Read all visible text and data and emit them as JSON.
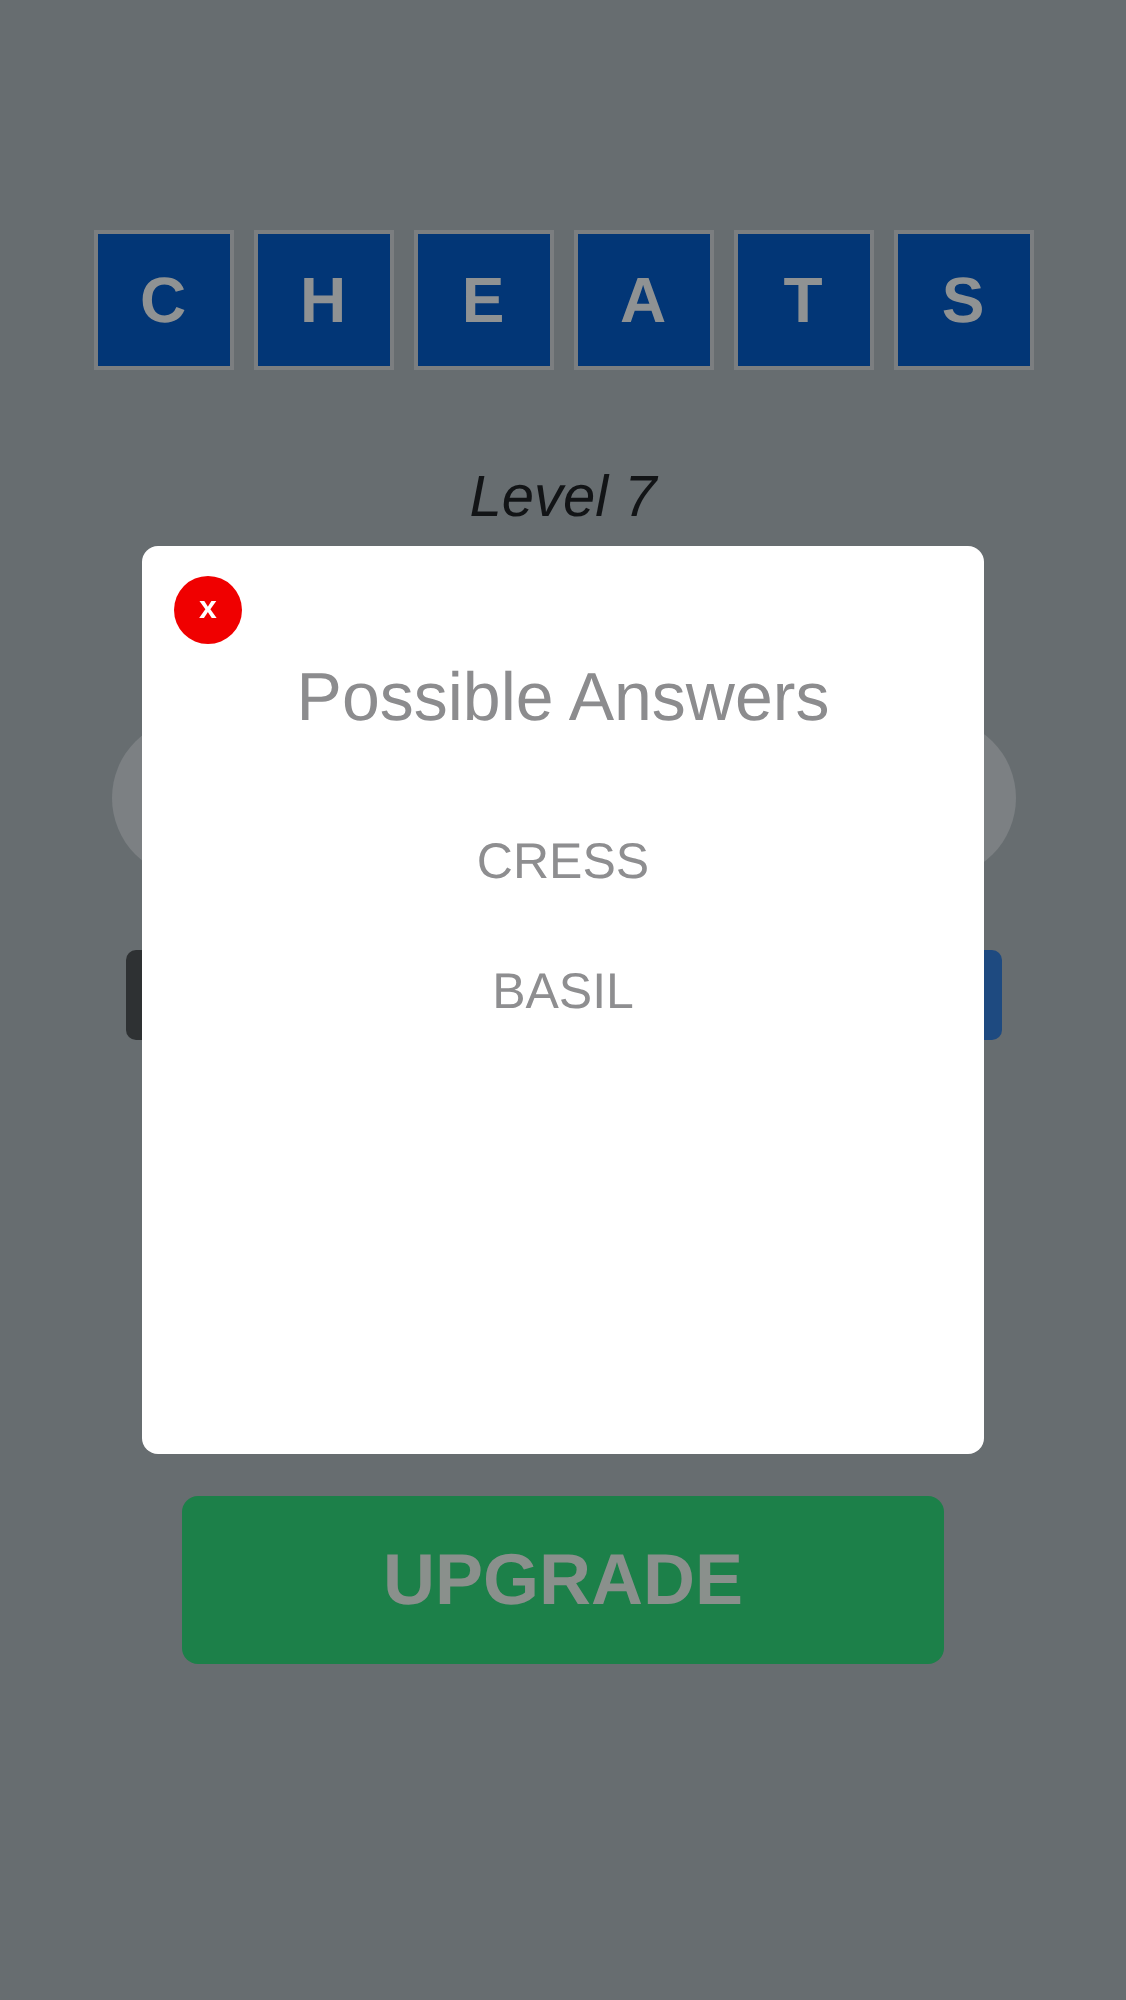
{
  "title_tiles": [
    "C",
    "H",
    "E",
    "A",
    "T",
    "S"
  ],
  "level": "Level 7",
  "upgrade_button": "UPGRADE",
  "dialog": {
    "close": "x",
    "title": "Possible Answers",
    "answers": [
      "CRESS",
      "BASIL"
    ]
  }
}
